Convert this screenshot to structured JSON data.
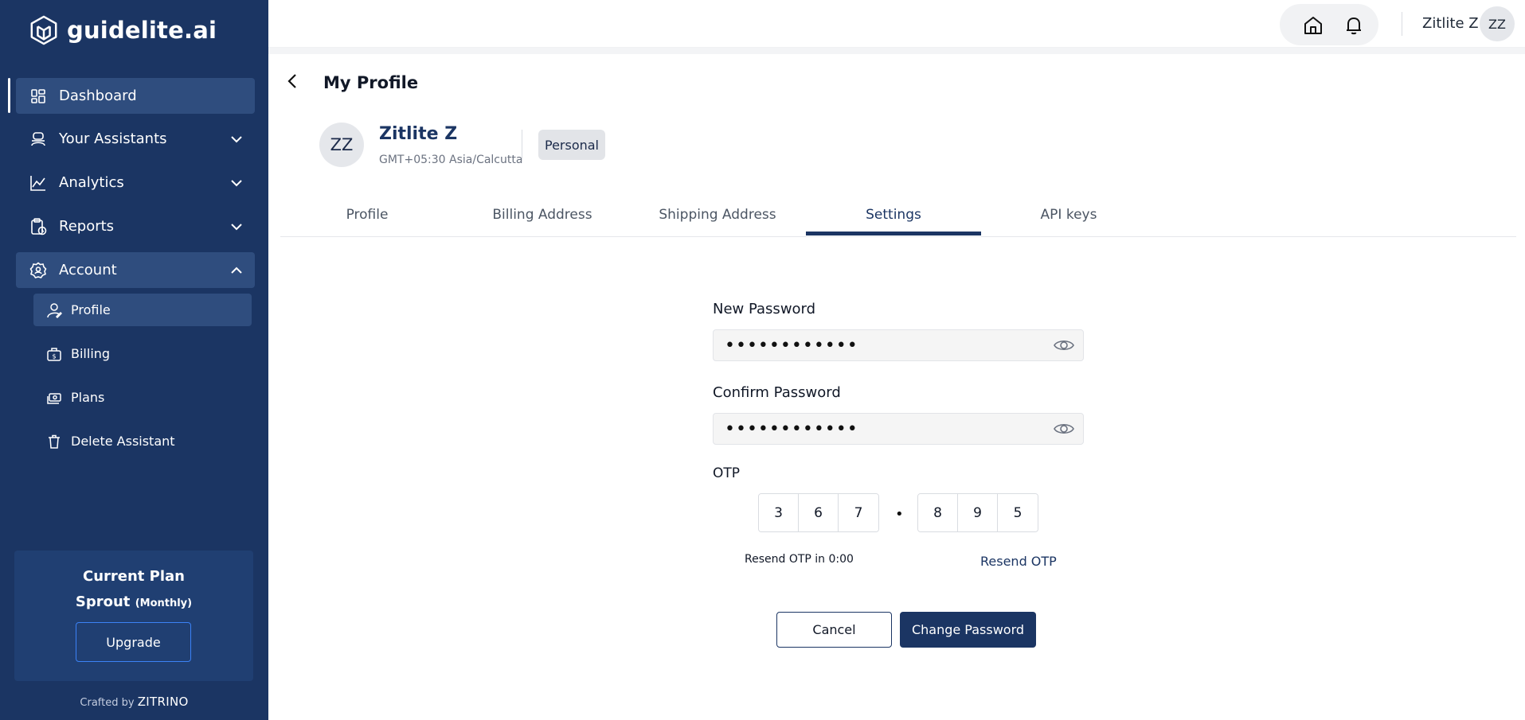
{
  "app": {
    "brand": "guidelite.ai",
    "crafted_prefix": "Crafted by",
    "crafted_brand": "ZITRINO"
  },
  "sidebar": {
    "items": [
      {
        "label": "Dashboard",
        "icon": "dashboard-icon"
      },
      {
        "label": "Your Assistants",
        "icon": "assistant-icon"
      },
      {
        "label": "Analytics",
        "icon": "analytics-icon"
      },
      {
        "label": "Reports",
        "icon": "reports-icon"
      },
      {
        "label": "Account",
        "icon": "account-icon"
      }
    ],
    "account_sub": [
      {
        "label": "Profile",
        "icon": "profile-icon"
      },
      {
        "label": "Billing",
        "icon": "billing-icon"
      },
      {
        "label": "Plans",
        "icon": "plans-icon"
      },
      {
        "label": "Delete Assistant",
        "icon": "trash-icon"
      }
    ]
  },
  "plan": {
    "title": "Current Plan",
    "name": "Sprout",
    "period": "(Monthly)",
    "upgrade_label": "Upgrade"
  },
  "topbar": {
    "user_name": "Zitlite Z",
    "avatar_initials": "ZZ"
  },
  "page": {
    "title": "My Profile"
  },
  "profile": {
    "initials": "ZZ",
    "name": "Zitlite Z",
    "timezone": "GMT+05:30 Asia/Calcutta",
    "badge": "Personal"
  },
  "tabs": [
    "Profile",
    "Billing Address",
    "Shipping Address",
    "Settings",
    "API keys"
  ],
  "form": {
    "new_password_label": "New Password",
    "new_password_value": "••••••••••••",
    "confirm_password_label": "Confirm Password",
    "confirm_password_value": "••••••••••••",
    "otp_label": "OTP",
    "otp_digits": [
      "3",
      "6",
      "7",
      "8",
      "9",
      "5"
    ],
    "otp_separator": "•",
    "resend_timer": "Resend OTP in 0:00",
    "resend_link": "Resend OTP",
    "cancel_label": "Cancel",
    "submit_label": "Change Password"
  },
  "colors": {
    "sidebar_bg": "#1b3563",
    "sidebar_active": "#2f4d7e",
    "primary": "#1b3563"
  }
}
